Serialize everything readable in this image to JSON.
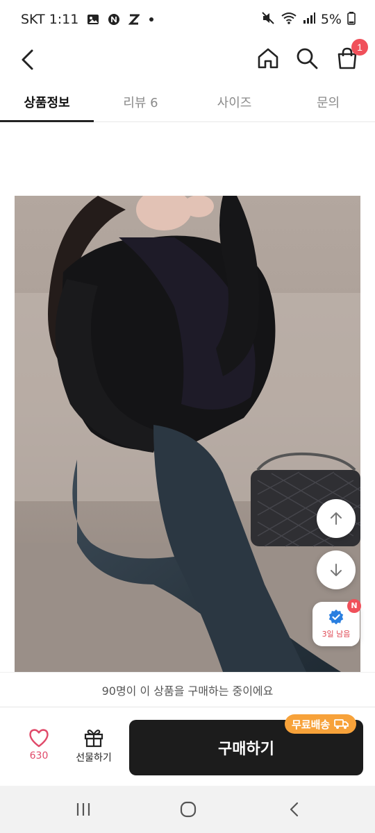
{
  "status_bar": {
    "carrier_time": "SKT 1:11",
    "battery": "5%",
    "icons": [
      "gallery-icon",
      "naver-icon",
      "z-icon",
      "dot-icon",
      "mute-icon",
      "wifi-icon",
      "signal-icon",
      "battery-icon"
    ]
  },
  "header": {
    "cart_badge": "1",
    "icons": [
      "back-arrow-icon",
      "home-icon",
      "search-icon",
      "shopping-bag-icon"
    ]
  },
  "tabs": [
    {
      "label": "상품정보",
      "active": true
    },
    {
      "label": "리뷰 6",
      "active": false
    },
    {
      "label": "사이즈",
      "active": false
    },
    {
      "label": "문의",
      "active": false
    }
  ],
  "floating": {
    "coupon_text": "3일 남음",
    "coupon_badge": "N",
    "icons": [
      "arrow-up-icon",
      "arrow-down-icon",
      "verified-badge-icon"
    ]
  },
  "notice": {
    "text": "90명이 이 상품을 구매하는 중이에요"
  },
  "action_bar": {
    "like_count": "630",
    "gift_label": "선물하기",
    "buy_label": "구매하기",
    "free_shipping_label": "무료배송",
    "accent_color": "#f7a23a",
    "like_color": "#e04a6a",
    "icons": [
      "heart-icon",
      "gift-icon",
      "truck-icon"
    ]
  },
  "system_nav": {
    "icons": [
      "recent-apps-icon",
      "home-circle-icon",
      "back-chevron-icon"
    ]
  }
}
